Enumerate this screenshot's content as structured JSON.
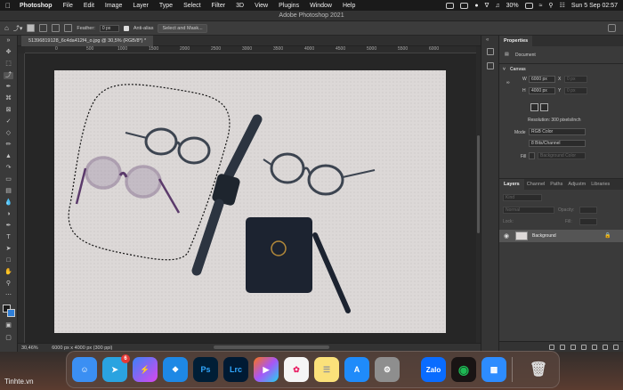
{
  "menubar": {
    "apple": "",
    "app": "Photoshop",
    "items": [
      "File",
      "Edit",
      "Image",
      "Layer",
      "Type",
      "Select",
      "Filter",
      "3D",
      "View",
      "Plugins",
      "Window",
      "Help"
    ],
    "battery": "30%",
    "clock": "Sun 5 Sep  02:57"
  },
  "titlebar": {
    "title": "Adobe Photoshop 2021"
  },
  "options": {
    "feather_label": "Feather:",
    "feather_value": "0 px",
    "antialias_label": "Anti-alias",
    "select_mask_label": "Select and Mask..."
  },
  "document": {
    "tab_title": "51396819128_6c4da412f4_o.jpg @ 30,5% (RGB/8*) *",
    "ruler_ticks": [
      "0",
      "500",
      "1000",
      "1500",
      "2000",
      "2500",
      "3000",
      "3500",
      "4000",
      "4500",
      "5000",
      "5500",
      "6000"
    ]
  },
  "status": {
    "zoom": "30,46%",
    "info": "6000 px x 4000 px (300 ppi)"
  },
  "properties": {
    "tab": "Properties",
    "kind": "Document",
    "section_canvas": "Canvas",
    "w_label": "W",
    "w_value": "6000 px",
    "h_label": "H",
    "h_value": "4000 px",
    "x_label": "X",
    "y_label": "Y",
    "x_placeholder": "0 px",
    "y_placeholder": "0 px",
    "resolution": "Resolution: 300 pixels/inch",
    "mode_label": "Mode",
    "mode_value": "RGB Color",
    "bits_value": "8 Bits/Channel",
    "fill_label": "Fill",
    "fill_value": "Background Color"
  },
  "layers": {
    "tabs": [
      "Layers",
      "Channel",
      "Paths",
      "Adjustm",
      "Libraries"
    ],
    "kind_placeholder": "Kind",
    "blend_mode": "Normal",
    "opacity_label": "Opacity:",
    "lock_label": "Lock:",
    "fill_label": "Fill:",
    "layer_name": "Background"
  },
  "dock": {
    "telegram_badge": "6",
    "apps": [
      {
        "name": "Finder",
        "label": "",
        "color": "#3b8ff3"
      },
      {
        "name": "Telegram",
        "label": "",
        "color": "#2aa3e0"
      },
      {
        "name": "Messenger",
        "label": "",
        "color": "#8b5cf6"
      },
      {
        "name": "Safari",
        "label": "",
        "color": "#1e88e5"
      },
      {
        "name": "Photoshop",
        "label": "Ps",
        "color": "#001e36"
      },
      {
        "name": "Lightroom",
        "label": "Lrc",
        "color": "#001a33"
      },
      {
        "name": "Final Cut",
        "label": "",
        "color": "#222"
      },
      {
        "name": "Photos",
        "label": "",
        "color": "#f5f5f5"
      },
      {
        "name": "Notes",
        "label": "",
        "color": "#fbe17a"
      },
      {
        "name": "App Store",
        "label": "",
        "color": "#1f8bfa"
      },
      {
        "name": "System Preferences",
        "label": "",
        "color": "#8e8e8e"
      },
      {
        "name": "Zalo",
        "label": "Zalo",
        "color": "#0a6cff"
      },
      {
        "name": "Spotify",
        "label": "",
        "color": "#1db954"
      },
      {
        "name": "Zoom",
        "label": "",
        "color": "#2d8cff"
      },
      {
        "name": "Trash",
        "label": "",
        "color": "#9aa0a6"
      }
    ]
  },
  "watermark": "Tinhte.vn",
  "colors": {
    "accent": "#1473e6",
    "panel": "#3a3a3a",
    "canvas_bg": "#262626"
  }
}
